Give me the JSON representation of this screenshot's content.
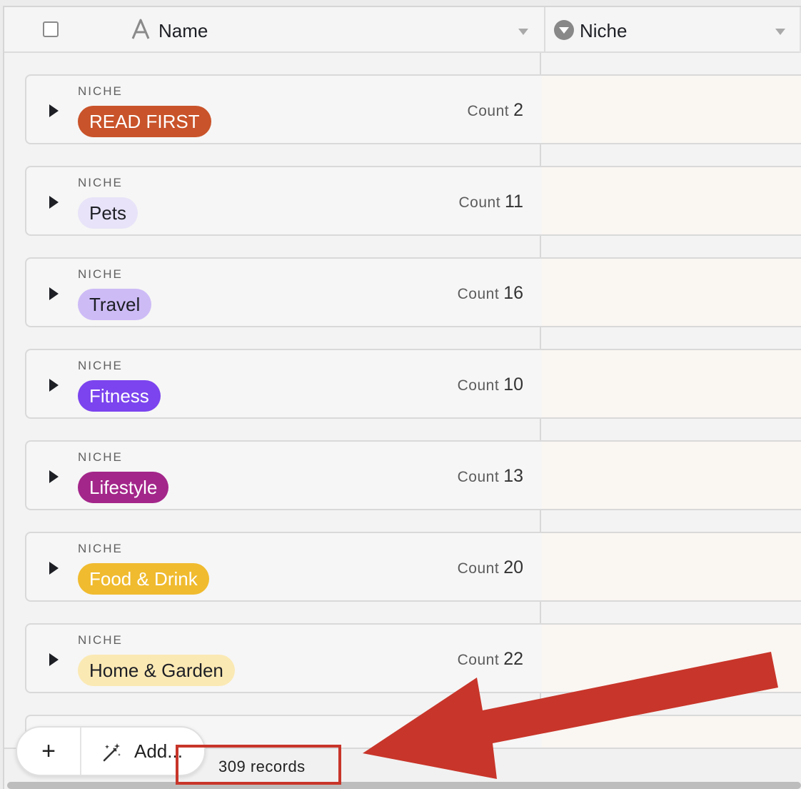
{
  "header": {
    "name_column": "Name",
    "niche_column": "Niche"
  },
  "group_caption": "NICHE",
  "count_label": "Count",
  "groups": [
    {
      "niche": "READ FIRST",
      "count": "2",
      "pill_bg": "#c9532a",
      "pill_fg": "#ffffff"
    },
    {
      "niche": "Pets",
      "count": "11",
      "pill_bg": "#e8e3f8",
      "pill_fg": "#1d1f25"
    },
    {
      "niche": "Travel",
      "count": "16",
      "pill_bg": "#cdbbf6",
      "pill_fg": "#1d1f25"
    },
    {
      "niche": "Fitness",
      "count": "10",
      "pill_bg": "#7b44ee",
      "pill_fg": "#ffffff"
    },
    {
      "niche": "Lifestyle",
      "count": "13",
      "pill_bg": "#a3268a",
      "pill_fg": "#ffffff"
    },
    {
      "niche": "Food & Drink",
      "count": "20",
      "pill_bg": "#f0bb2f",
      "pill_fg": "#ffffff"
    },
    {
      "niche": "Home & Garden",
      "count": "22",
      "pill_bg": "#fbe9b4",
      "pill_fg": "#1d1f25"
    }
  ],
  "toolbar": {
    "plus_label": "+",
    "add_label": "Add..."
  },
  "footer": {
    "records_count": "309 records"
  },
  "colors": {
    "annotation_red": "#c8352a"
  }
}
